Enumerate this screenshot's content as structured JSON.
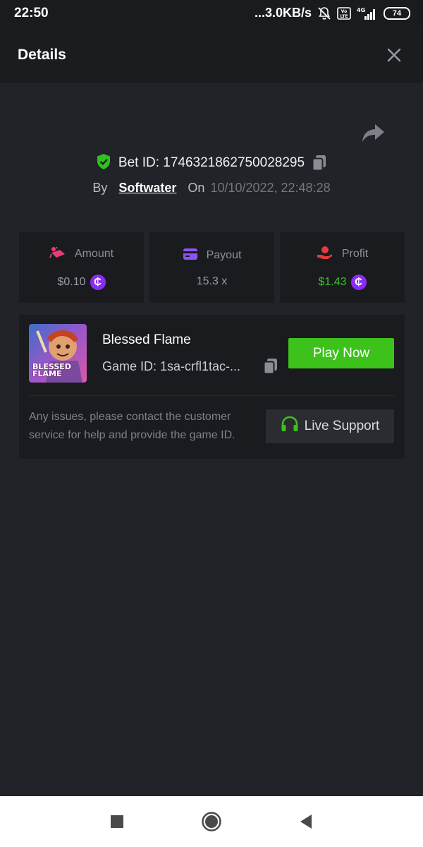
{
  "status_bar": {
    "time": "22:50",
    "network_speed": "...3.0KB/s",
    "network_type": "4G",
    "battery": "74",
    "icons": [
      "bell-off-icon",
      "volte-icon",
      "signal-icon",
      "battery-icon"
    ]
  },
  "header": {
    "title": "Details",
    "close_icon": "close-icon"
  },
  "bet": {
    "id_label": "Bet ID: 1746321862750028295",
    "by_label": "By",
    "by_user": "Softwater",
    "on_label": "On",
    "date": "10/10/2022, 22:48:28"
  },
  "stats": [
    {
      "label": "Amount",
      "value": "$0.10",
      "icon": "bet-amount-icon",
      "color": "#e73d7a"
    },
    {
      "label": "Payout",
      "value": "15.3 x",
      "icon": "card-icon",
      "color": "#8e54f2"
    },
    {
      "label": "Profit",
      "value": "$1.43",
      "icon": "profit-hand-icon",
      "color": "#e63b3b"
    }
  ],
  "game": {
    "title": "Blessed Flame",
    "game_id": "Game ID: 1sa-crfl1tac-...",
    "thumb_text": [
      "BLESSED",
      "FLAME"
    ],
    "play_label": "Play Now",
    "help_text": "Any issues, please contact the customer service for help and provide the game ID.",
    "support_label": "Live Support"
  },
  "colors": {
    "background": "#222328",
    "card": "#1a1b1f",
    "accent_green": "#3cc21b",
    "coin": "#8b2cf5"
  }
}
